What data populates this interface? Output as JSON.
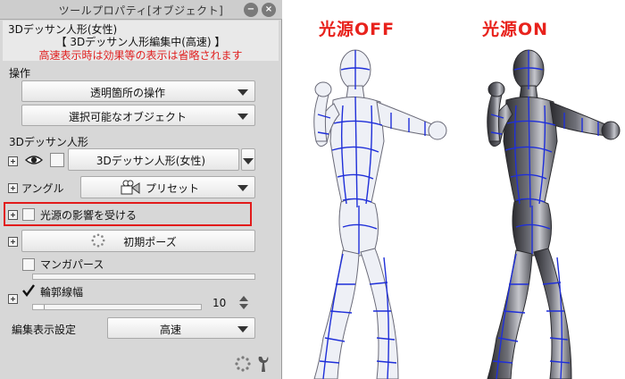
{
  "window": {
    "title": "ツールプロパティ[オブジェクト]"
  },
  "header": {
    "object_name": "3Dデッサン人形(女性)",
    "mode": "【 3Dデッサン人形編集中(高速) 】",
    "warning": "高速表示時は効果等の表示は省略されます"
  },
  "operation": {
    "section_label": "操作",
    "transparent_dropdown": "透明箇所の操作",
    "selectable_dropdown": "選択可能なオブジェクト"
  },
  "doll": {
    "section_label": "3Dデッサン人形",
    "model_dropdown": "3Dデッサン人形(女性)"
  },
  "angle": {
    "label": "アングル",
    "preset_dropdown": "プリセット"
  },
  "light": {
    "label": "光源の影響を受ける",
    "checked": false
  },
  "pose": {
    "reset_button": "初期ポーズ"
  },
  "manga_perspective": {
    "label": "マンガパース",
    "checked": false
  },
  "outline": {
    "label": "輪郭線幅",
    "checked": true,
    "value": "10"
  },
  "display": {
    "label": "編集表示設定",
    "value": "高速"
  },
  "comparison": {
    "off_label": "光源OFF",
    "on_label": "光源ON"
  },
  "colors": {
    "warning": "#e02020",
    "highlight_border": "#e21b1b",
    "mesh": "#1f2fd9",
    "label_red": "#e8221c"
  },
  "icons": {
    "eye": "eye-icon",
    "preset": "camera-preset-icon",
    "reset": "spinner-icon",
    "footer": "settings-wrench-icon"
  }
}
